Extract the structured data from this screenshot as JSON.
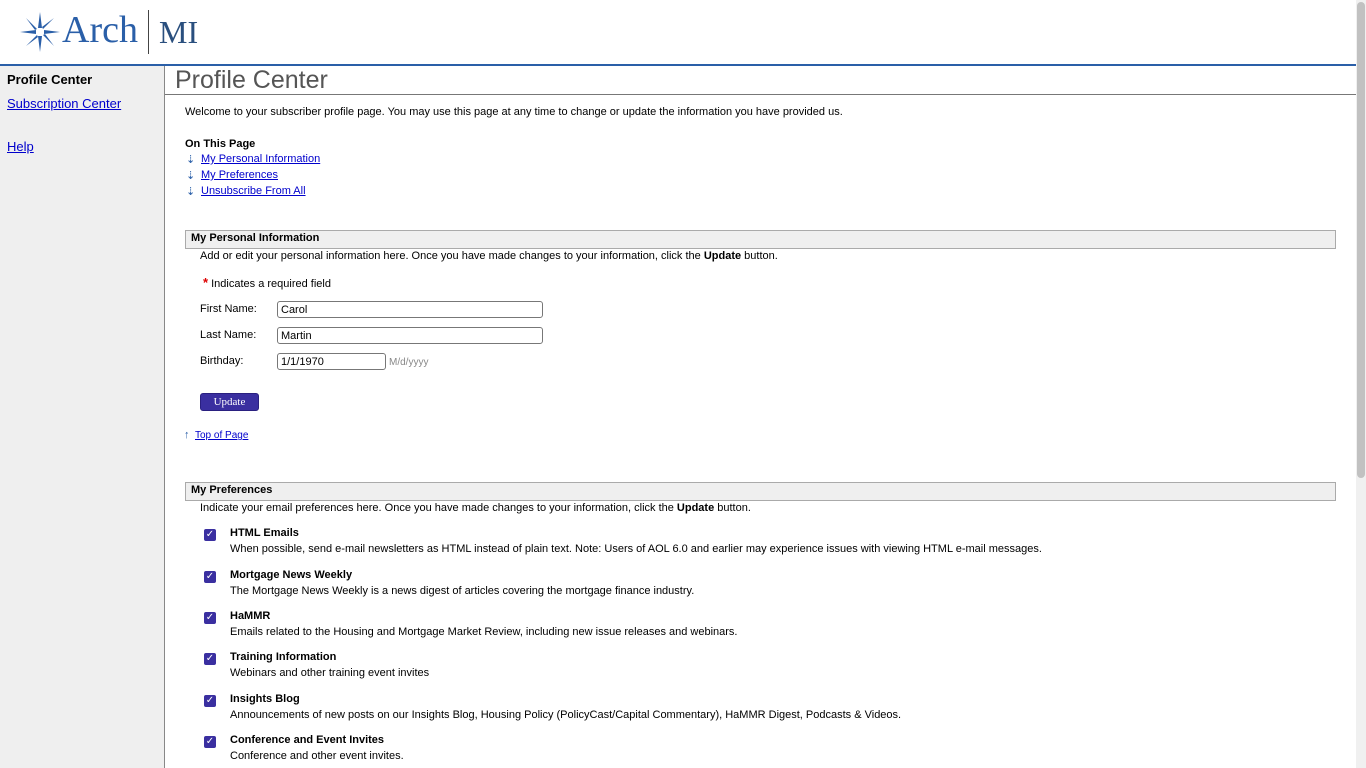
{
  "brand": {
    "name": "Arch",
    "sub": "MI",
    "color": "#2a5fa8"
  },
  "sidebar": {
    "title": "Profile Center",
    "links": [
      "Subscription Center",
      "Help"
    ]
  },
  "main": {
    "title": "Profile Center",
    "welcome": "Welcome to your subscriber profile page. You may use this page at any time to change or update the information you have provided us.",
    "on_this_page": "On This Page",
    "toc": [
      "My Personal Information",
      "My Preferences",
      "Unsubscribe From All"
    ]
  },
  "personal": {
    "header": "My Personal Information",
    "intro_pre": "Add or edit your personal information here. Once you have made changes to your information, click the ",
    "intro_bold": "Update",
    "intro_post": " button.",
    "required_mark": "*",
    "required_text": "Indicates a required field",
    "first_label": "First Name:",
    "first_value": "Carol",
    "last_label": "Last Name:",
    "last_value": "Martin",
    "birthday_label": "Birthday:",
    "birthday_value": "1/1/1970",
    "birthday_hint": "M/d/yyyy",
    "update_button": "Update",
    "top_link": "Top of Page"
  },
  "preferences": {
    "header": "My Preferences",
    "intro_pre": "Indicate your email preferences here. Once you have made changes to your information, click the ",
    "intro_bold": "Update",
    "intro_post": " button.",
    "items": [
      {
        "title": "HTML Emails",
        "desc": "When possible, send e-mail newsletters as HTML instead of plain text. Note: Users of AOL 6.0 and earlier may experience issues with viewing HTML e-mail messages.",
        "checked": true
      },
      {
        "title": "Mortgage News Weekly",
        "desc": "The Mortgage News Weekly is a news digest of articles covering the mortgage finance industry.",
        "checked": true
      },
      {
        "title": "HaMMR",
        "desc": "Emails related to the Housing and Mortgage Market Review, including new issue releases and webinars.",
        "checked": true
      },
      {
        "title": "Training Information",
        "desc": "Webinars and other training event invites",
        "checked": true
      },
      {
        "title": "Insights Blog",
        "desc": "Announcements of new posts on our Insights Blog, Housing Policy (PolicyCast/Capital Commentary), HaMMR Digest, Podcasts & Videos.",
        "checked": true
      },
      {
        "title": "Conference and Event Invites",
        "desc": "Conference and other event invites.",
        "checked": true
      }
    ]
  }
}
